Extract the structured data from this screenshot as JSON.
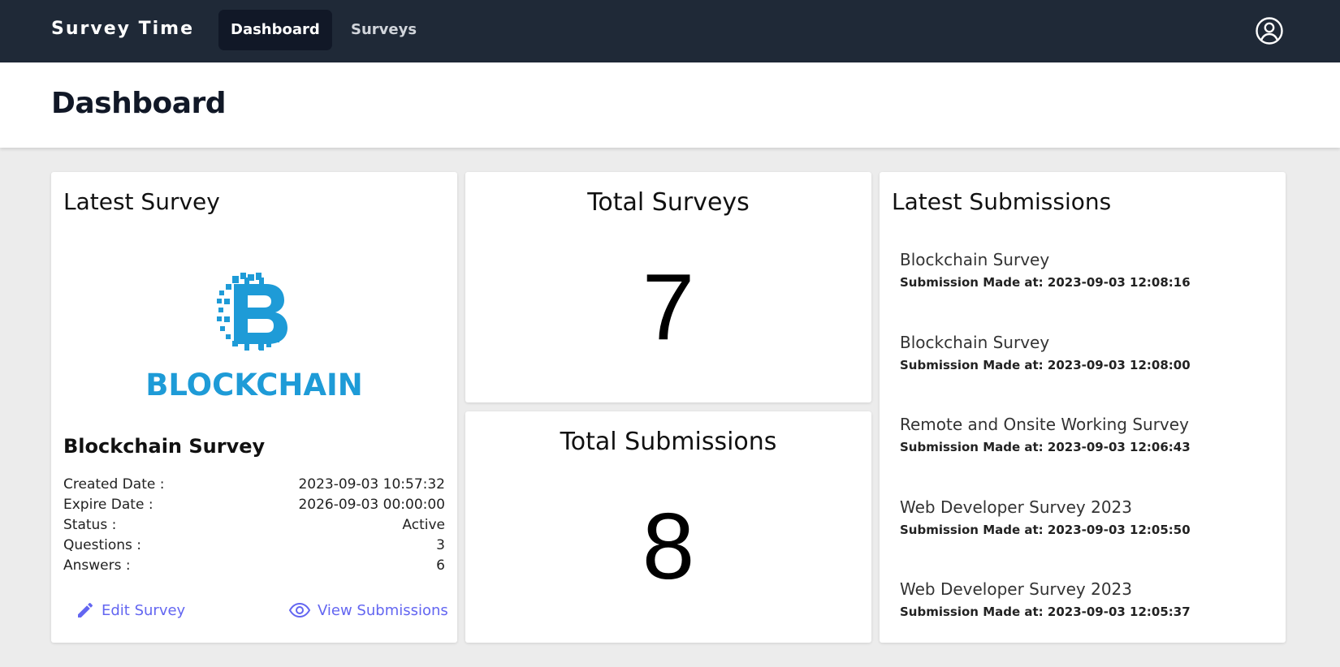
{
  "app": {
    "brand": "Survey Time",
    "nav": [
      {
        "label": "Dashboard",
        "active": true
      },
      {
        "label": "Surveys",
        "active": false
      }
    ],
    "user_icon": "user-circle-icon"
  },
  "page": {
    "title": "Dashboard"
  },
  "latest_survey": {
    "heading": "Latest Survey",
    "image_text": "BLOCKCHAIN",
    "image_icon": "blockchain-bitcoin-logo",
    "name": "Blockchain Survey",
    "fields": [
      {
        "label": "Created Date :",
        "value": "2023-09-03 10:57:32"
      },
      {
        "label": "Expire Date :",
        "value": "2026-09-03 00:00:00"
      },
      {
        "label": "Status :",
        "value": "Active"
      },
      {
        "label": "Questions :",
        "value": "3"
      },
      {
        "label": "Answers :",
        "value": "6"
      }
    ],
    "edit_label": "Edit Survey",
    "view_label": "View Submissions"
  },
  "stats": {
    "total_surveys": {
      "label": "Total Surveys",
      "value": "7"
    },
    "total_submissions": {
      "label": "Total Submissions",
      "value": "8"
    }
  },
  "latest_submissions": {
    "heading": "Latest Submissions",
    "items": [
      {
        "title": "Blockchain Survey",
        "made_at": "Submission Made at: 2023-09-03 12:08:16"
      },
      {
        "title": "Blockchain Survey",
        "made_at": "Submission Made at: 2023-09-03 12:08:00"
      },
      {
        "title": "Remote and Onsite Working Survey",
        "made_at": "Submission Made at: 2023-09-03 12:06:43"
      },
      {
        "title": "Web Developer Survey 2023",
        "made_at": "Submission Made at: 2023-09-03 12:05:50"
      },
      {
        "title": "Web Developer Survey 2023",
        "made_at": "Submission Made at: 2023-09-03 12:05:37"
      }
    ]
  },
  "colors": {
    "nav_bg": "#1f2937",
    "accent": "#6366f1",
    "blockchain_blue": "#1e9bd7"
  }
}
